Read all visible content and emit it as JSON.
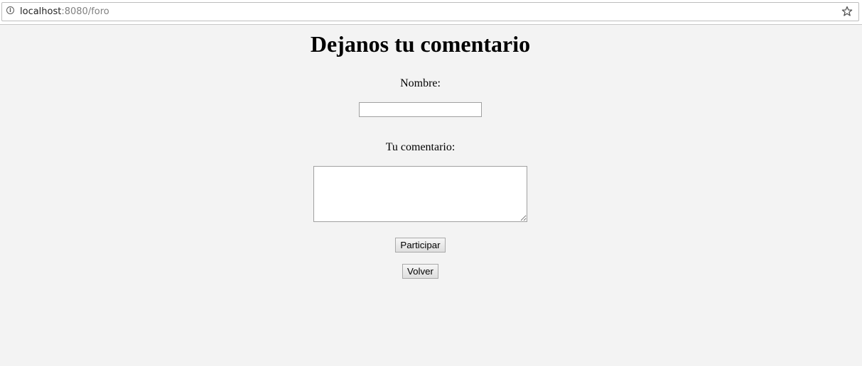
{
  "browser": {
    "url_host": "localhost",
    "url_rest": ":8080/foro"
  },
  "form": {
    "title": "Dejanos tu comentario",
    "name_label": "Nombre:",
    "name_value": "",
    "comment_label": "Tu comentario:",
    "comment_value": "",
    "submit_label": "Participar",
    "back_label": "Volver"
  },
  "icons": {
    "site_info": "info-icon",
    "bookmark": "star-icon"
  }
}
